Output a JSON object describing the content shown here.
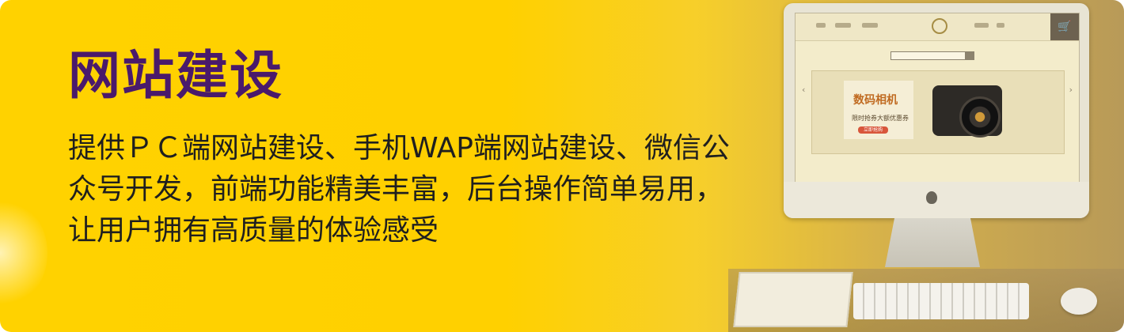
{
  "banner": {
    "title": "网站建设",
    "description": "提供ＰＣ端网站建设、手机WAP端网站建设、微信公众号开发，前端功能精美丰富，后台操作简单易用，让用户拥有高质量的体验感受",
    "title_color": "#4a1a6b",
    "background_color": "#ffd200"
  },
  "illustration": {
    "screen_promo_title": "数码相机",
    "screen_promo_subtitle": "限时抢券大额优惠券",
    "screen_promo_button": "立即抢购",
    "icons": [
      "imac-computer",
      "camera",
      "keyboard",
      "mouse",
      "tablet",
      "apple-logo",
      "cart-icon",
      "search-icon"
    ]
  }
}
